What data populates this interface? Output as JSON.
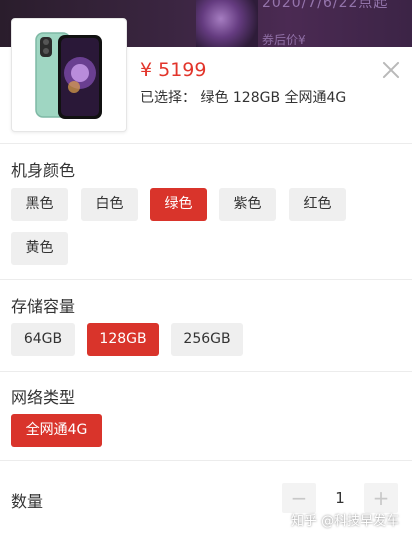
{
  "backdrop": {
    "title_fragment": "2020/7/6/22点起",
    "price_fragment": "券后价¥"
  },
  "product": {
    "price": "¥ 5199",
    "selected": "已选择： 绿色 128GB 全网通4G",
    "icons": {
      "close": "close-icon",
      "thumbnail": "phone-thumbnail-icon"
    }
  },
  "sections": {
    "color": {
      "title": "机身颜色",
      "options": [
        "黑色",
        "白色",
        "绿色",
        "紫色",
        "红色",
        "黄色"
      ],
      "selected": "绿色"
    },
    "storage": {
      "title": "存储容量",
      "options": [
        "64GB",
        "128GB",
        "256GB"
      ],
      "selected": "128GB"
    },
    "network": {
      "title": "网络类型",
      "options": [
        "全网通4G"
      ],
      "selected": "全网通4G"
    }
  },
  "quantity": {
    "label": "数量",
    "value": "1",
    "minus": "−",
    "plus": "+"
  },
  "watermark": "知乎 @科技早发车",
  "colors": {
    "accent": "#d9342b",
    "price": "#e2352b",
    "chip": "#efefef"
  }
}
